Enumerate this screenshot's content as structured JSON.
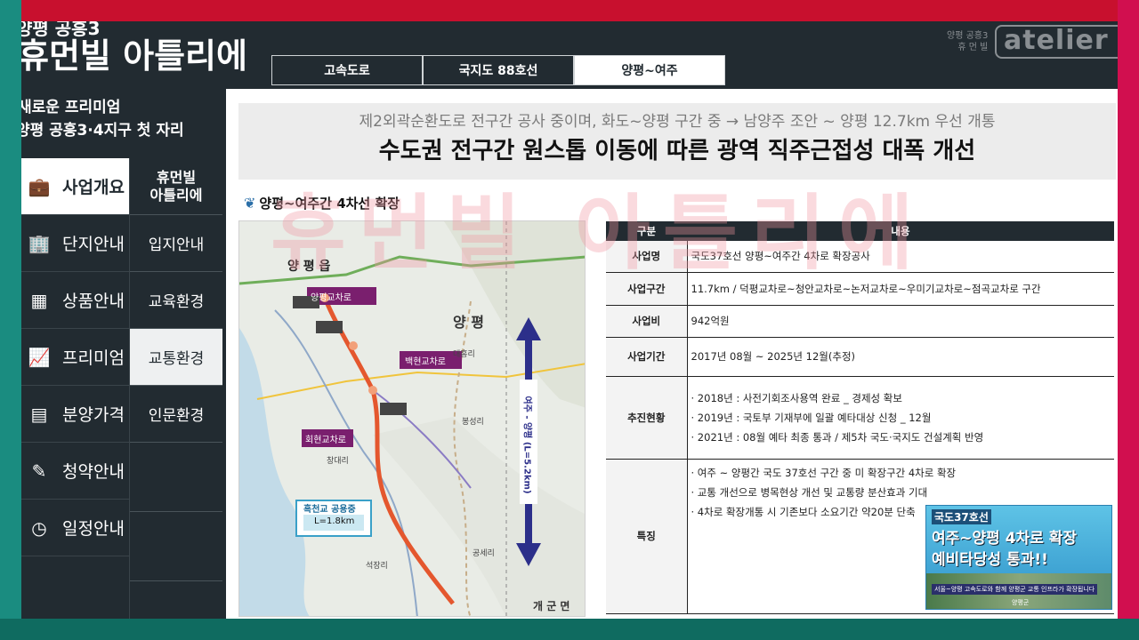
{
  "brand": {
    "subtitle": "양평 공흥3",
    "title": "휴먼빌 아틀리에",
    "tagline1": "새로운 프리미엄",
    "tagline2": "양평 공흥3·4지구 첫 자리",
    "logo_small": "양평 공흥3\n휴 먼 빌",
    "logo": "atelier"
  },
  "tabs": [
    {
      "label": "고속도로"
    },
    {
      "label": "국지도 88호선"
    },
    {
      "label": "양평~여주"
    }
  ],
  "nav_primary": [
    {
      "icon": "briefcase-icon",
      "glyph": "💼",
      "label": "사업개요"
    },
    {
      "icon": "building-icon",
      "glyph": "🏢",
      "label": "단지안내"
    },
    {
      "icon": "floorplan-icon",
      "glyph": "▦",
      "label": "상품안내"
    },
    {
      "icon": "trend-icon",
      "glyph": "📈",
      "label": "프리미엄"
    },
    {
      "icon": "calculator-icon",
      "glyph": "▤",
      "label": "분양가격"
    },
    {
      "icon": "edit-icon",
      "glyph": "✎",
      "label": "청약안내"
    },
    {
      "icon": "clock-icon",
      "glyph": "◷",
      "label": "일정안내"
    }
  ],
  "nav_secondary": {
    "header": "휴먼빌\n아틀리에",
    "items": [
      {
        "label": "입지안내"
      },
      {
        "label": "교육환경"
      },
      {
        "label": "교통환경"
      },
      {
        "label": "인문환경"
      }
    ]
  },
  "banner": {
    "subtitle": "제2외곽순환도로 전구간 공사 중이며, 화도~양평 구간 중 → 남양주 조안 ~ 양평 12.7km 우선 개통",
    "title": "수도권 전구간 원스톱 이동에 따른 광역 직주근접성 대폭 개선"
  },
  "watermark": "휴먼빌 아틀리에",
  "section_title": "양평~여주간 4차선 확장",
  "map": {
    "town_name": "양 평 읍",
    "region": "양 평",
    "label_yangpyeong_ic": "양평교차로",
    "label_baekhyeon_ic": "백현교차로",
    "label_hoehyeon_ic": "회현교차로",
    "label_heukcheon": "흑천교 공용중",
    "label_heukcheon_len": "L=1.8km",
    "label_route": "여주 - 양평 (L=5.2km)",
    "label_gaegun": "개 군 면",
    "label_daeheung": "대흥리",
    "label_bongseong": "봉성리",
    "label_changdae": "창대리",
    "label_gongse": "공세리",
    "label_seokjang": "석장리"
  },
  "table": {
    "headers": [
      "구분",
      "내용"
    ],
    "rows": [
      {
        "key": "사업명",
        "lines": [
          "국도37호선 양평~여주간 4차로 확장공사"
        ]
      },
      {
        "key": "사업구간",
        "lines": [
          "11.7km / 덕평교차로~청안교차로~논저교차로~우미기교차로~점곡교차로 구간"
        ]
      },
      {
        "key": "사업비",
        "lines": [
          "942억원"
        ]
      },
      {
        "key": "사업기간",
        "lines": [
          "2017년 08월 ~ 2025년 12월(추정)"
        ]
      },
      {
        "key": "추진현황",
        "lines": [
          "· 2018년 : 사전기회조사용역 완료 _ 경제성 확보",
          "· 2019년 : 국토부 기재부에 일괄 예타대상 신청 _ 12월",
          "· 2021년 : 08월 예타 최종 통과 / 제5차 국도·국지도 건설계획 반영"
        ]
      },
      {
        "key": "특징",
        "lines": [
          "· 여주 ~ 양평간 국도 37호선 구간 중 미 확장구간 4차로 확장",
          "· 교통 개선으로 병목현상 개선 및 교통량 분산효과 기대",
          "· 4차로 확장개통 시 기존보다 소요기간 약20분 단축"
        ]
      }
    ]
  },
  "ad": {
    "line1": "국도37호선",
    "line2": "여주~양평 4차로 확장",
    "line3": "예비타당성 통과!!",
    "footer": "서울~양평 고속도로와 함께 양평군 교통 인프라가 확장됩니다",
    "logo": "양평군"
  },
  "colors": {
    "frame_red": "#c8102e",
    "frame_teal": "#1a8c80",
    "dark": "#222b31",
    "route_red": "#e4572e",
    "route_blue": "#2c2f8a",
    "label_purple": "#7a1f6e"
  }
}
